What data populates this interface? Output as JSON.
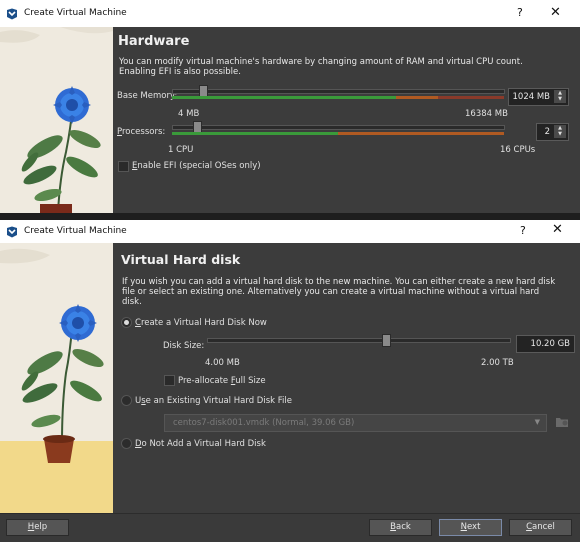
{
  "window1": {
    "title": "Create Virtual Machine",
    "help": "?",
    "close": "✕",
    "heading": "Hardware",
    "description_line1": "You can modify virtual machine's hardware by changing amount of RAM and virtual CPU count.",
    "description_line2": "Enabling EFI is also possible.",
    "memory": {
      "label": "Base Memory:",
      "value": "1024 MB",
      "min_label": "4 MB",
      "max_label": "16384 MB",
      "level_fraction": 0.062
    },
    "processors": {
      "label": "Processors:",
      "value": "2",
      "min_label": "1 CPU",
      "max_label": "16 CPUs",
      "level_fraction": 0.067
    },
    "efi": {
      "label": "Enable EFI (special OSes only)",
      "checked": false
    }
  },
  "window2": {
    "title": "Create Virtual Machine",
    "help": "?",
    "close": "✕",
    "heading": "Virtual Hard disk",
    "description_line1": "If you wish you can add a virtual hard disk to the new machine. You can either create a new hard disk",
    "description_line2": "file or select an existing one. Alternatively you can create a virtual machine without a virtual hard",
    "description_line3": "disk.",
    "options": {
      "create_new": {
        "label": "Create a Virtual Hard Disk Now",
        "selected": true
      },
      "use_existing": {
        "label": "Use an Existing Virtual Hard Disk File",
        "selected": false
      },
      "no_disk": {
        "label": "Do Not Add a Virtual Hard Disk",
        "selected": false
      }
    },
    "disk_size": {
      "label": "Disk Size:",
      "value": "10.20 GB",
      "min_label": "4.00 MB",
      "max_label": "2.00 TB",
      "level_fraction": 0.62
    },
    "preallocate": {
      "label": "Pre-allocate Full Size",
      "checked": false
    },
    "existing_file": {
      "value": "centos7-disk001.vmdk (Normal, 39.06 GB)"
    },
    "buttons": {
      "help": "Help",
      "back": "Back",
      "next": "Next",
      "cancel": "Cancel"
    }
  },
  "colors": {
    "window_bg": "#3c3c3c",
    "titlebar_bg": "#ffffff",
    "green_zone": "#3a9a3a",
    "orange_zone": "#b05a22",
    "red_zone": "#8a3a2a"
  }
}
